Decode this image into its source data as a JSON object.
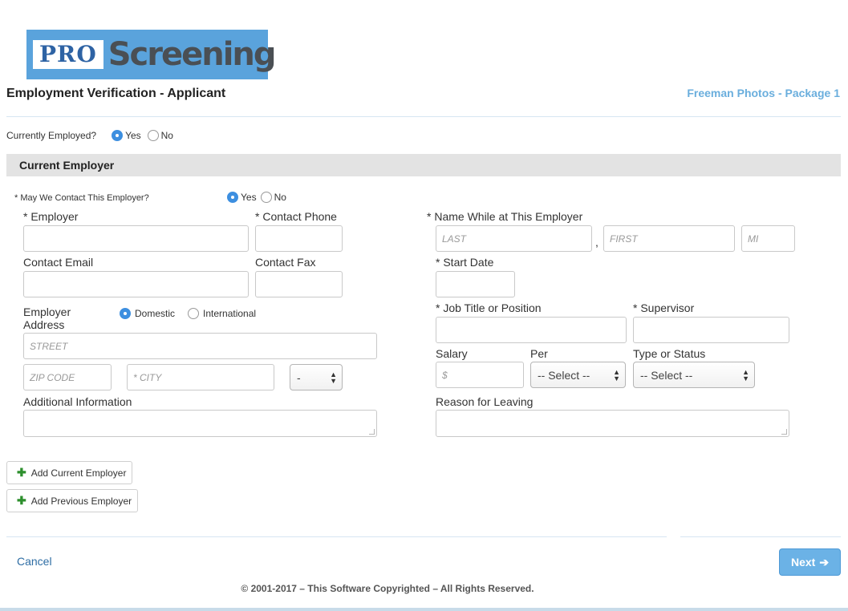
{
  "logo": {
    "pro": "PRO",
    "screening": "Screening"
  },
  "header": {
    "title": "Employment Verification - Applicant",
    "package": "Freeman Photos - Package 1"
  },
  "currently_employed": {
    "label": "Currently Employed?",
    "yes": "Yes",
    "no": "No",
    "selected": "Yes"
  },
  "section": {
    "title": "Current Employer"
  },
  "contact_employer": {
    "label": "* May We Contact This Employer?",
    "yes": "Yes",
    "no": "No",
    "selected": "Yes"
  },
  "fields": {
    "employer": {
      "label": "* Employer",
      "value": ""
    },
    "contact_phone": {
      "label": "* Contact Phone",
      "value": ""
    },
    "contact_email": {
      "label": "Contact Email",
      "value": ""
    },
    "contact_fax": {
      "label": "Contact Fax",
      "value": ""
    },
    "employer_address": {
      "label_line1": "Employer",
      "label_line2": "Address",
      "domestic": "Domestic",
      "international": "International",
      "selected": "Domestic",
      "street_placeholder": "STREET",
      "zip_placeholder": "ZIP CODE",
      "city_placeholder": "* CITY",
      "state_value": "-"
    },
    "additional_info": {
      "label": "Additional Information",
      "value": ""
    },
    "name_while": {
      "label": "* Name While at This Employer",
      "last_placeholder": "LAST",
      "comma": ",",
      "first_placeholder": "FIRST",
      "mi_placeholder": "MI"
    },
    "start_date": {
      "label": "* Start Date",
      "value": ""
    },
    "job_title": {
      "label": "* Job Title or Position",
      "value": ""
    },
    "supervisor": {
      "label": "* Supervisor",
      "value": ""
    },
    "salary": {
      "label": "Salary",
      "placeholder": "$"
    },
    "per": {
      "label": "Per",
      "value": "-- Select --"
    },
    "type_status": {
      "label": "Type or Status",
      "value": "-- Select --"
    },
    "reason_leaving": {
      "label": "Reason for Leaving",
      "value": ""
    }
  },
  "buttons": {
    "add_current": "Add Current Employer",
    "add_previous": "Add Previous Employer",
    "cancel": "Cancel",
    "next": "Next",
    "next_arrow": "➔"
  },
  "footer": {
    "copyright": "© 2001-2017 – This Software Copyrighted – All Rights Reserved."
  },
  "colors": {
    "accent": "#6bb2e6",
    "link": "#2e6da4",
    "logo_bg": "#5aa3dc"
  }
}
